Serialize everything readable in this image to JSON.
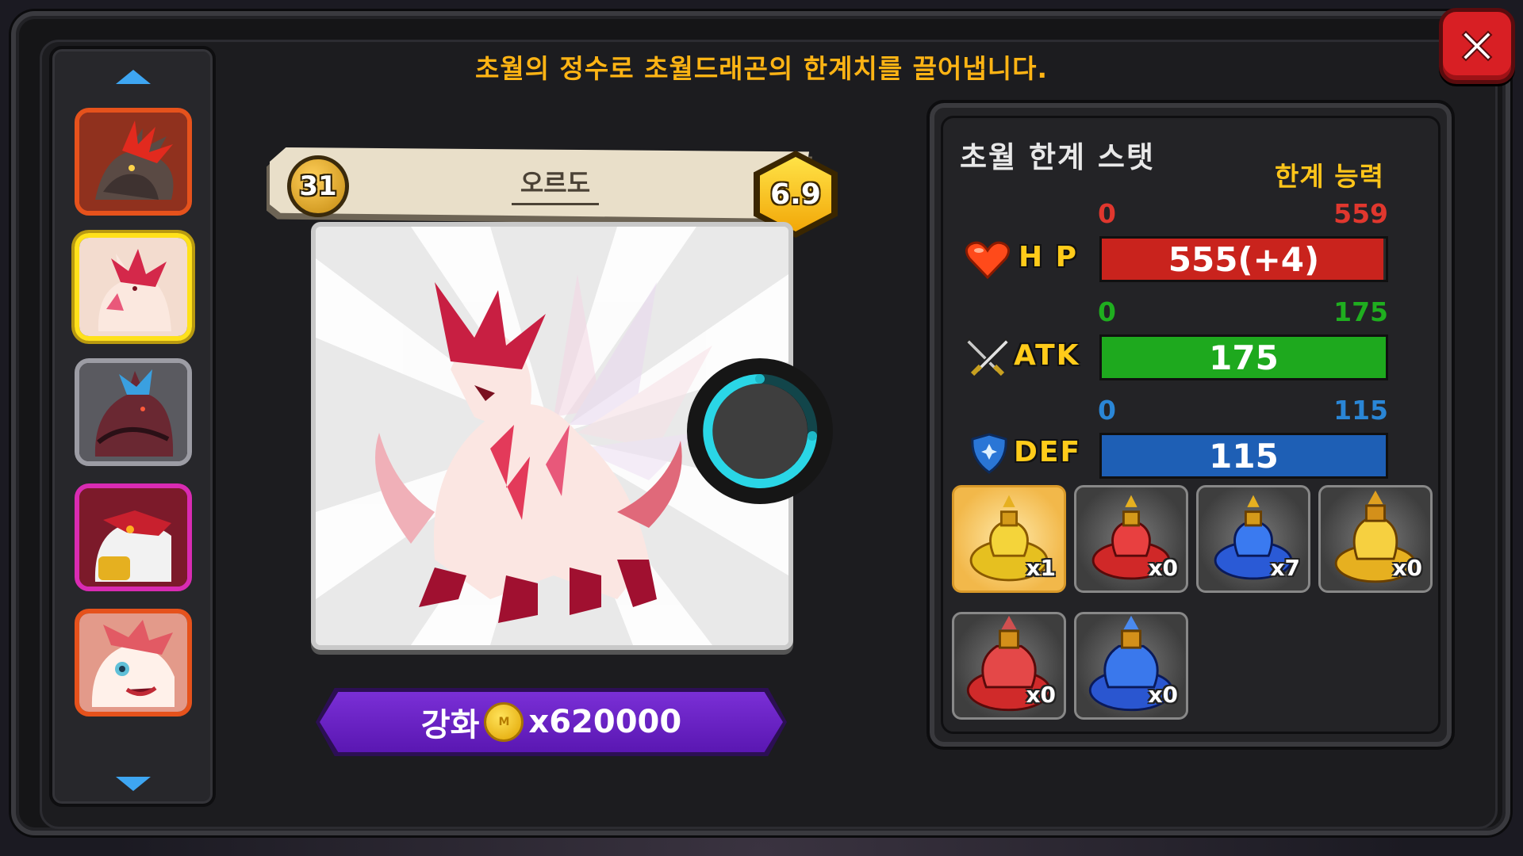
{
  "header": {
    "message": "초월의 정수로 초월드래곤의 한계치를 끌어냅니다."
  },
  "icons": {
    "close": "close-x-icon",
    "scroll_up": "chevron-up-icon",
    "scroll_down": "chevron-down-icon",
    "hp": "heart-icon",
    "atk": "crossed-swords-icon",
    "def": "shield-icon",
    "coin": "gold-coin-icon"
  },
  "dragon_list": [
    {
      "name": "dragon-portrait-1",
      "selected": false
    },
    {
      "name": "dragon-portrait-2",
      "selected": true
    },
    {
      "name": "dragon-portrait-3",
      "selected": false
    },
    {
      "name": "dragon-portrait-4",
      "selected": false
    },
    {
      "name": "dragon-portrait-5",
      "selected": false
    }
  ],
  "dragon": {
    "level": "31",
    "name": "오르도",
    "grade": "6.9"
  },
  "upgrade": {
    "label": "강화",
    "cost": "x620000",
    "coin_mark": "M"
  },
  "stats_panel": {
    "title": "초월 한계 스탯",
    "subtitle": "한계 능력",
    "stats": [
      {
        "key": "hp",
        "label": "H P",
        "min": "0",
        "max": "559",
        "value_text": "555(+4)",
        "value": 555,
        "max_value": 559,
        "color": "#c9231d",
        "scale_color": "#e0372e"
      },
      {
        "key": "atk",
        "label": "ATK",
        "min": "0",
        "max": "175",
        "value_text": "175",
        "value": 175,
        "max_value": 175,
        "color": "#1ea91e",
        "scale_color": "#1fae1f"
      },
      {
        "key": "def",
        "label": "DEF",
        "min": "0",
        "max": "115",
        "value_text": "115",
        "value": 115,
        "max_value": 115,
        "color": "#1e5fb5",
        "scale_color": "#2a86d6"
      }
    ]
  },
  "potions": [
    {
      "color": "yellow",
      "count": "x1",
      "selected": true
    },
    {
      "color": "red",
      "count": "x0",
      "selected": false
    },
    {
      "color": "blue",
      "count": "x7",
      "selected": false
    },
    {
      "color": "gold",
      "count": "x0",
      "selected": false
    },
    {
      "color": "red-large",
      "count": "x0",
      "selected": false
    },
    {
      "color": "blue-large",
      "count": "x0",
      "selected": false
    }
  ]
}
